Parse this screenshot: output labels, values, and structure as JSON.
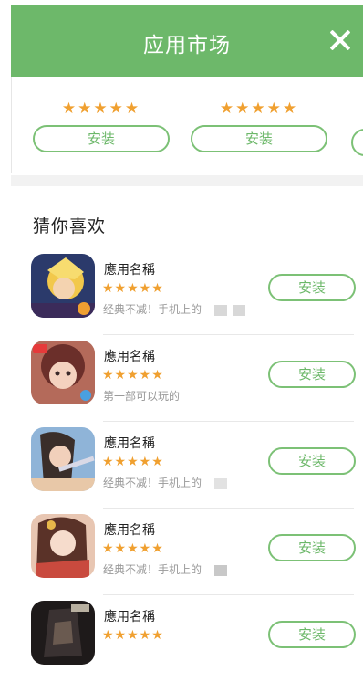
{
  "header": {
    "title": "应用市场"
  },
  "top_row": [
    {
      "stars": "★★★★★",
      "install_label": "安装"
    },
    {
      "stars": "★★★★★",
      "install_label": "安装"
    }
  ],
  "section": {
    "title": "猜你喜欢"
  },
  "apps": [
    {
      "name": "應用名稱",
      "stars": "★★★★★",
      "desc": "经典不减！手机上的",
      "install_label": "安装"
    },
    {
      "name": "應用名稱",
      "stars": "★★★★★",
      "desc": "第一部可以玩的",
      "install_label": "安装"
    },
    {
      "name": "應用名稱",
      "stars": "★★★★★",
      "desc": "经典不减！手机上的",
      "install_label": "安装"
    },
    {
      "name": "應用名稱",
      "stars": "★★★★★",
      "desc": "经典不减！手机上的",
      "install_label": "安装"
    },
    {
      "name": "應用名稱",
      "stars": "★★★★★",
      "desc": "",
      "install_label": "安装"
    }
  ],
  "colors": {
    "accent": "#6db86a",
    "star": "#f0a030"
  },
  "icons": [
    "close-icon",
    "star-icon",
    "app-icon"
  ]
}
